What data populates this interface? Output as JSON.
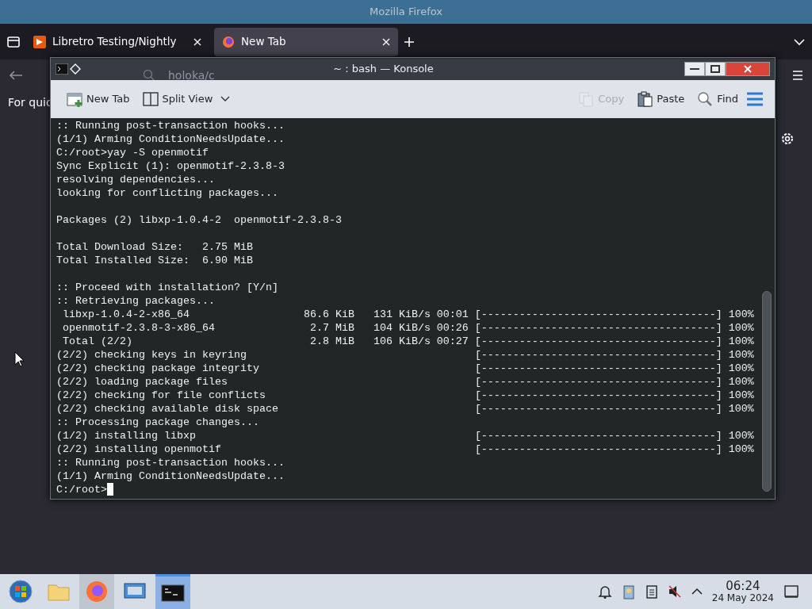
{
  "firefox": {
    "title": "Mozilla Firefox",
    "tabs": [
      {
        "label": "Libretro Testing/Nightly",
        "selected": false,
        "kind": "libretro"
      },
      {
        "label": "New Tab",
        "selected": true,
        "kind": "firefox"
      }
    ],
    "address_text": "holoka/c",
    "content_text": "For quic"
  },
  "konsole": {
    "title": "~ : bash — Konsole",
    "toolbar": [
      {
        "label": "New Tab",
        "kind": "newtab",
        "disabled": false
      },
      {
        "label": "Split View",
        "kind": "split",
        "disabled": false
      },
      {
        "label": "Copy",
        "kind": "copy",
        "disabled": true
      },
      {
        "label": "Paste",
        "kind": "paste",
        "disabled": false
      },
      {
        "label": "Find",
        "kind": "find",
        "disabled": false
      }
    ],
    "lines": [
      {
        "text": ":: Running post-transaction hooks..."
      },
      {
        "text": "(1/1) Arming ConditionNeedsUpdate..."
      },
      {
        "text": "C:/root>yay -S openmotif"
      },
      {
        "text": "Sync Explicit (1): openmotif-2.3.8-3"
      },
      {
        "text": "resolving dependencies..."
      },
      {
        "text": "looking for conflicting packages..."
      },
      {
        "blank_before": true,
        "text": "Packages (2) libxp-1.0.4-2  openmotif-2.3.8-3"
      },
      {
        "blank_before": true,
        "text": "Total Download Size:   2.75 MiB"
      },
      {
        "text": "Total Installed Size:  6.90 MiB"
      },
      {
        "blank_before": true,
        "text": ":: Proceed with installation? [Y/n]"
      },
      {
        "text": ":: Retrieving packages..."
      },
      {
        "text": " libxp-1.0.4-2-x86_64",
        "size": "86.6 KiB",
        "rate": "131 KiB/s",
        "time": "00:01",
        "bar": "[-------------------------------------]",
        "percent": "100%"
      },
      {
        "text": " openmotif-2.3.8-3-x86_64",
        "size": "2.7 MiB",
        "rate": "104 KiB/s",
        "time": "00:26",
        "bar": "[-------------------------------------]",
        "percent": "100%"
      },
      {
        "text": " Total (2/2)",
        "size": "2.8 MiB",
        "rate": "106 KiB/s",
        "time": "00:27",
        "bar": "[-------------------------------------]",
        "percent": "100%"
      },
      {
        "text": "(2/2) checking keys in keyring",
        "bar": "[-------------------------------------]",
        "percent": "100%"
      },
      {
        "text": "(2/2) checking package integrity",
        "bar": "[-------------------------------------]",
        "percent": "100%"
      },
      {
        "text": "(2/2) loading package files",
        "bar": "[-------------------------------------]",
        "percent": "100%"
      },
      {
        "text": "(2/2) checking for file conflicts",
        "bar": "[-------------------------------------]",
        "percent": "100%"
      },
      {
        "text": "(2/2) checking available disk space",
        "bar": "[-------------------------------------]",
        "percent": "100%"
      },
      {
        "text": ":: Processing package changes..."
      },
      {
        "text": "(1/2) installing libxp",
        "bar": "[-------------------------------------]",
        "percent": "100%"
      },
      {
        "text": "(2/2) installing openmotif",
        "bar": "[-------------------------------------]",
        "percent": "100%"
      },
      {
        "text": ":: Running post-transaction hooks..."
      },
      {
        "text": "(1/1) Arming ConditionNeedsUpdate..."
      },
      {
        "text": "C:/root>",
        "cursor": true
      }
    ]
  },
  "taskbar": {
    "apps": [
      {
        "kind": "start",
        "selected": false
      },
      {
        "kind": "folder",
        "selected": false
      },
      {
        "kind": "firefox",
        "selected": false,
        "active": true
      },
      {
        "kind": "settings",
        "selected": false
      },
      {
        "kind": "terminal",
        "selected": true
      }
    ],
    "clock": {
      "time": "06:24",
      "date": "24 May 2024"
    }
  }
}
